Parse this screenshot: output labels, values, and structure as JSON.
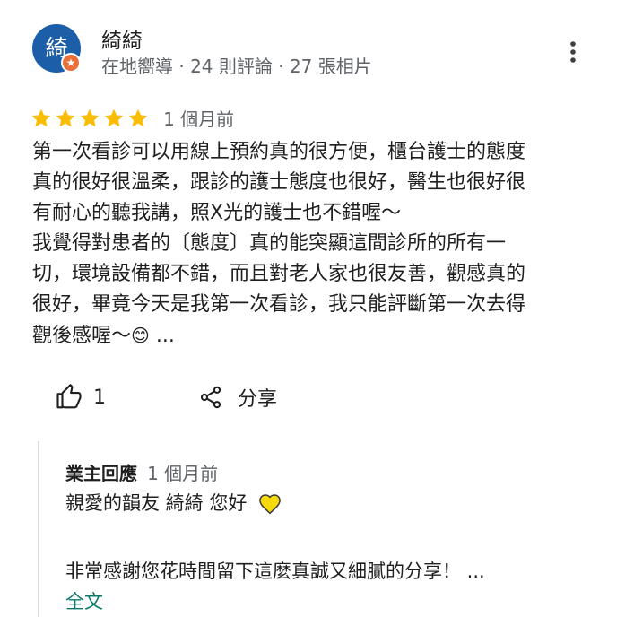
{
  "reviewer": {
    "avatar_char": "綺",
    "badge_char": "★",
    "name": "綺綺",
    "meta": "在地嚮導 · 24 則評論 · 27 張相片"
  },
  "review": {
    "stars": 5,
    "star_color": "#fbbc04",
    "time": "1 個月前",
    "text_body": "第一次看診可以用線上預約真的很方便，櫃台護士的態度\n真的很好很溫柔，跟診的護士態度也很好，醫生也很好很\n有耐心的聽我講，照X光的護士也不錯喔～\n我覺得對患者的〔態度〕真的能突顯這間診所的所有一\n切，環境設備都不錯，而且對老人家也很友善，觀感真的\n很好，畢竟今天是我第一次看診，我只能評斷第一次去得\n觀後感喔～",
    "text_emoji": "😊",
    "text_ellipsis": " ..."
  },
  "actions": {
    "like_count": "1",
    "share_label": "分享"
  },
  "owner_reply": {
    "owner_label": "業主回應",
    "time": "1 個月前",
    "line1": "親愛的韻友 綺綺 您好",
    "line2": "非常感謝您花時間留下這麼真誠又細膩的分享！ ...",
    "more_link": "全文",
    "link_color": "#0b7a6a",
    "heart_color": "#f5d90a"
  }
}
